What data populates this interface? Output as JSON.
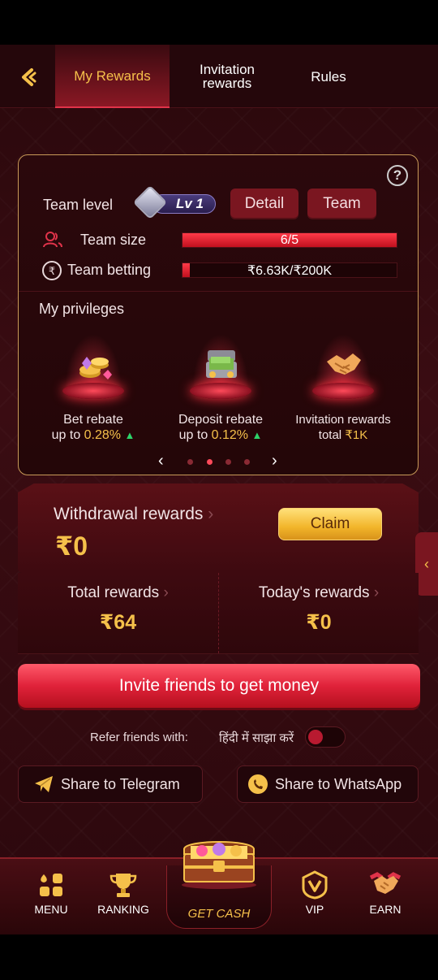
{
  "header": {
    "tabs": [
      {
        "label": "My Rewards",
        "active": true
      },
      {
        "label": "Invitation\nrewards",
        "active": false
      },
      {
        "label": "Rules",
        "active": false
      }
    ]
  },
  "team": {
    "level_label": "Team level",
    "level_badge": "Lv 1",
    "detail_label": "Detail",
    "team_label": "Team",
    "size_label": "Team size",
    "size_value": "6/5",
    "size_progress": 1.0,
    "betting_label": "Team betting",
    "betting_value": "₹6.63K/₹200K",
    "betting_progress": 0.033,
    "help_icon": "?"
  },
  "privileges": {
    "title": "My privileges",
    "items": [
      {
        "line1": "Bet rebate",
        "line2_prefix": "up to ",
        "line2_value": "0.28%",
        "icon": "coins-gems-icon",
        "arrow": "▲"
      },
      {
        "line1": "Deposit rebate",
        "line2_prefix": "up to ",
        "line2_value": "0.12%",
        "icon": "treasure-chest-cash-icon",
        "arrow": "▲"
      },
      {
        "line1": "Invitation rewards",
        "line2_prefix": "total ",
        "line2_value": "₹1K",
        "icon": "handshake-icon",
        "arrow": ""
      }
    ],
    "prev": "‹",
    "next": "›",
    "active_dot": 1
  },
  "withdrawal": {
    "label": "Withdrawal rewards",
    "chevron": "›",
    "amount": "₹0",
    "claim_label": "Claim"
  },
  "totals": {
    "total_label": "Total rewards",
    "total_value": "₹64",
    "today_label": "Today's rewards",
    "today_value": "₹0",
    "chevron": "›"
  },
  "invite_button": "Invite friends to get money",
  "refer": {
    "label": "Refer friends with:",
    "language": "हिंदी में साझा करें",
    "toggle_on": false
  },
  "share": {
    "telegram": "Share to Telegram",
    "whatsapp": "Share to WhatsApp"
  },
  "bottom_nav": {
    "menu": "MENU",
    "ranking": "RANKING",
    "get_cash": "GET CASH",
    "vip": "VIP",
    "earn": "EARN"
  },
  "colors": {
    "accent_gold": "#f5c04a",
    "accent_red": "#e0223a",
    "background": "#2a080c"
  }
}
